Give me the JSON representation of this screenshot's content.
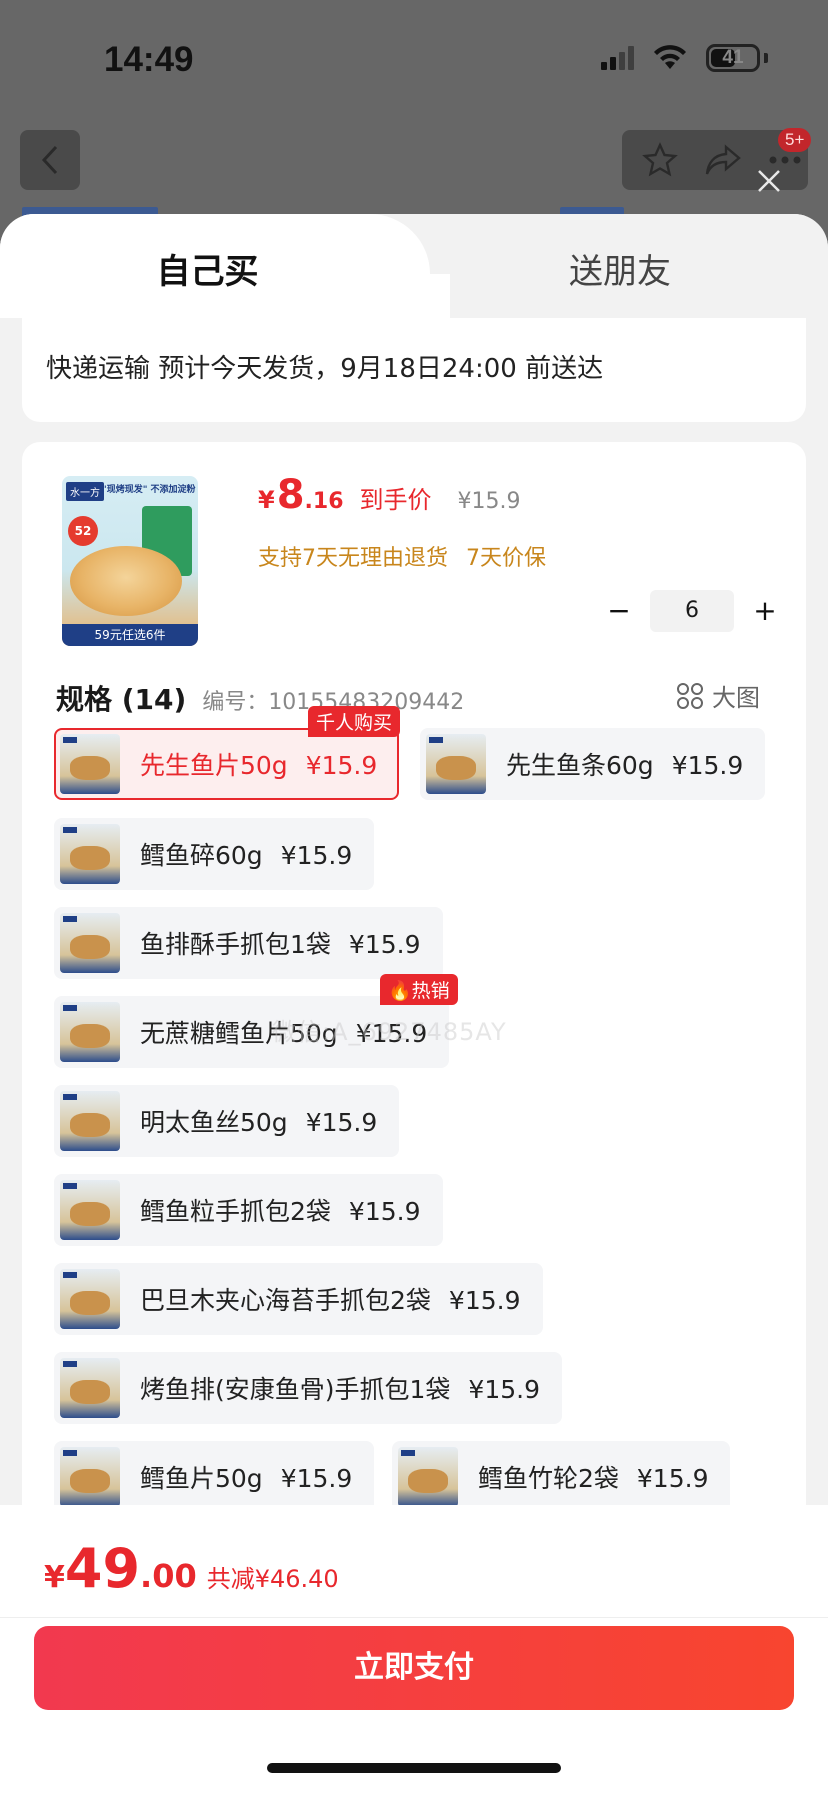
{
  "status_bar": {
    "time": "14:49",
    "battery": "41"
  },
  "nav": {
    "badge": "5+"
  },
  "tabs": [
    {
      "label": "自己买",
      "active": true
    },
    {
      "label": "送朋友",
      "active": false
    }
  ],
  "shipping": {
    "text": "快递运输 预计今天发货，9月18日24:00 前送达"
  },
  "product": {
    "thumb_brand": "水一方",
    "thumb_tagline": "\"现烤现发\" 不添加淀粉",
    "thumb_badge": "52",
    "thumb_bar": "59元任选6件",
    "price_symbol": "¥",
    "price_int": "8",
    "price_dec": ".16",
    "price_label": "到手价",
    "orig_price": "¥15.9",
    "services": [
      "支持7天无理由退货",
      "7天价保"
    ],
    "quantity": "6",
    "minus": "−",
    "plus": "+"
  },
  "spec": {
    "title": "规格 (14)",
    "code": "编号：10155483209442",
    "bigview": "大图",
    "watermark": "微信:A_6927485AY",
    "options": [
      {
        "label": "先生鱼片50g",
        "price": "¥15.9",
        "tag": "千人购买",
        "selected": true
      },
      {
        "label": "先生鱼条60g",
        "price": "¥15.9"
      },
      {
        "label": "鳕鱼碎60g",
        "price": "¥15.9"
      },
      {
        "label": "鱼排酥手抓包1袋",
        "price": "¥15.9"
      },
      {
        "label": "无蔗糖鳕鱼片50g",
        "price": "¥15.9",
        "tag": "热销"
      },
      {
        "label": "明太鱼丝50g",
        "price": "¥15.9"
      },
      {
        "label": "鳕鱼粒手抓包2袋",
        "price": "¥15.9"
      },
      {
        "label": "巴旦木夹心海苔手抓包2袋",
        "price": "¥15.9"
      },
      {
        "label": "烤鱼排(安康鱼骨)手抓包1袋",
        "price": "¥15.9"
      },
      {
        "label": "鳕鱼片50g",
        "price": "¥15.9"
      },
      {
        "label": "鳕鱼竹轮2袋",
        "price": "¥15.9"
      }
    ]
  },
  "footer": {
    "total_symbol": "¥",
    "total_int": "49",
    "total_dec": ".00",
    "saving": "共减¥46.40",
    "pay_label": "立即支付"
  },
  "colors": {
    "accent": "#e8282d",
    "service": "#c8861c",
    "brand": "#1f3f86"
  }
}
